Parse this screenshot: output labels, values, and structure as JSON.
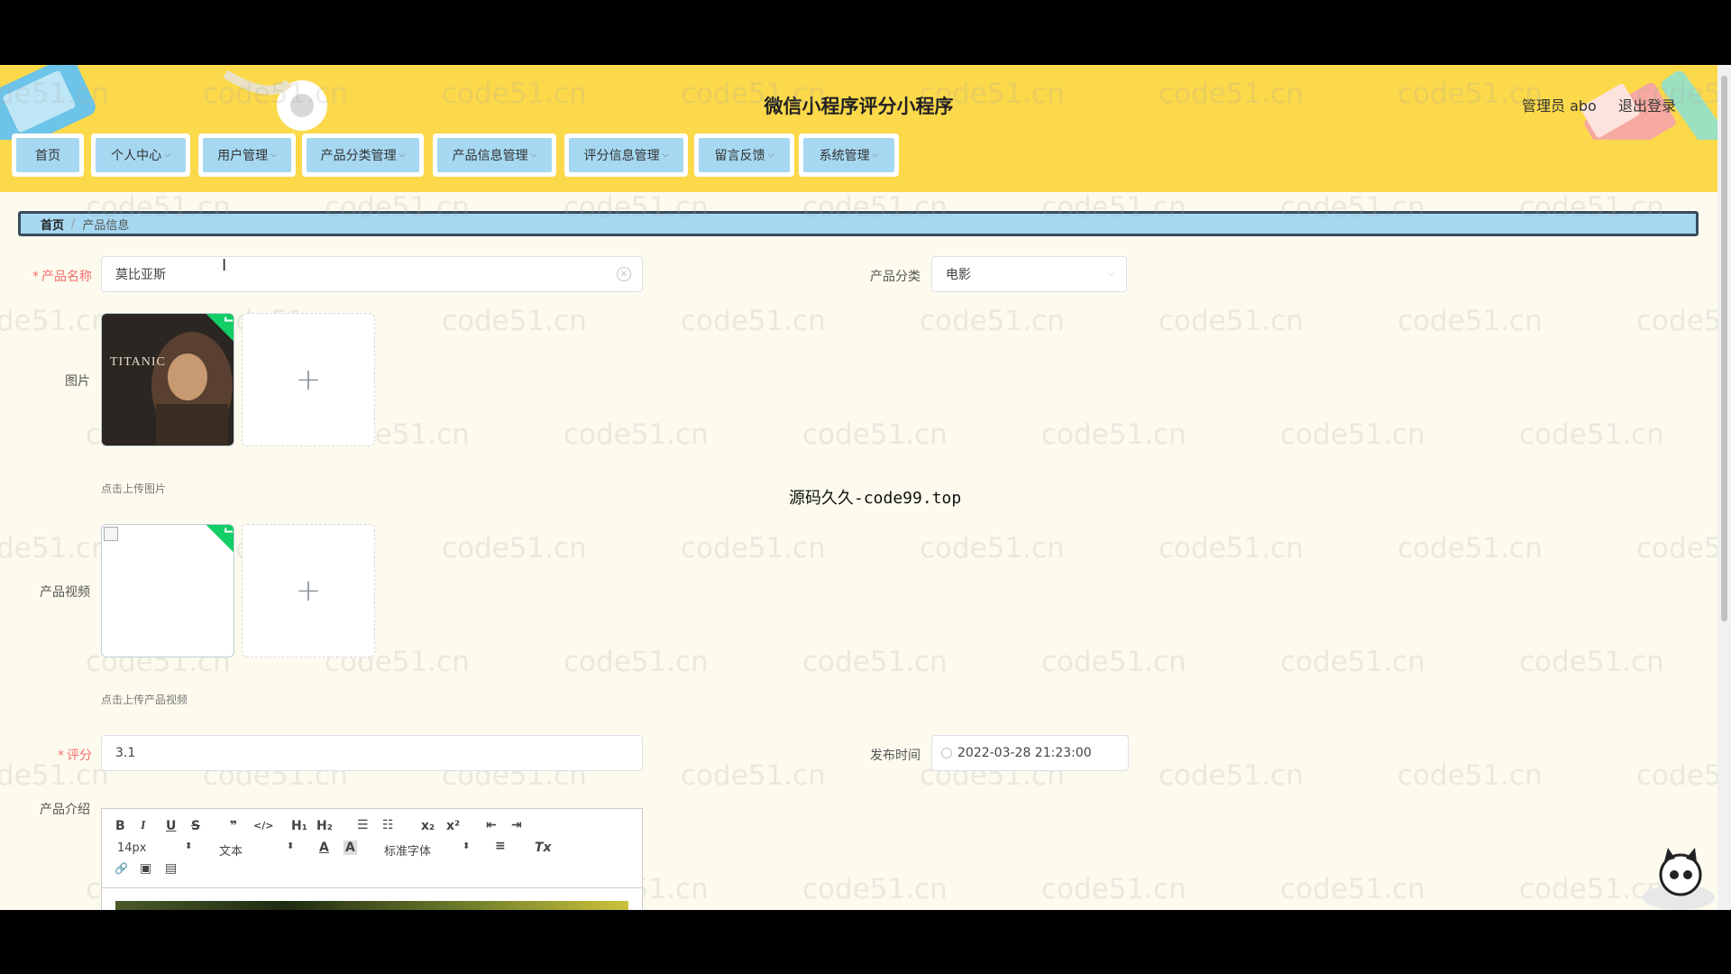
{
  "app": {
    "title": "微信小程序评分小程序"
  },
  "header": {
    "user": "管理员 abo",
    "logout": "退出登录"
  },
  "nav": [
    {
      "label": "首页",
      "dropdown": false
    },
    {
      "label": "个人中心",
      "dropdown": true
    },
    {
      "label": "用户管理",
      "dropdown": true
    },
    {
      "label": "产品分类管理",
      "dropdown": true
    },
    {
      "label": "产品信息管理",
      "dropdown": true
    },
    {
      "label": "评分信息管理",
      "dropdown": true
    },
    {
      "label": "留言反馈",
      "dropdown": true
    },
    {
      "label": "系统管理",
      "dropdown": true
    }
  ],
  "breadcrumb": {
    "home": "首页",
    "separator": "/",
    "current": "产品信息"
  },
  "watermark": "code51.cn",
  "overlay": "源码久久-code99.top",
  "form": {
    "name": {
      "label": "产品名称",
      "value": "莫比亚斯"
    },
    "category": {
      "label": "产品分类",
      "value": "电影"
    },
    "image": {
      "label": "图片",
      "hint": "点击上传图片",
      "poster_text": "TITANIC"
    },
    "video": {
      "label": "产品视频",
      "hint": "点击上传产品视频"
    },
    "score": {
      "label": "评分",
      "value": "3.1"
    },
    "publish_time": {
      "label": "发布时间",
      "value": "2022-03-28 21:23:00"
    },
    "intro": {
      "label": "产品介绍"
    }
  },
  "editor": {
    "font_size": "14px",
    "block_type": "文本",
    "font_family": "标准字体",
    "buttons": {
      "bold": "B",
      "italic": "I",
      "underline": "U",
      "strike": "S",
      "quote": "❞",
      "code": "</>",
      "h1": "H₁",
      "h2": "H₂",
      "ol": "☰",
      "ul": "☷",
      "sub": "x₂",
      "sup": "x²",
      "outdent": "⇤",
      "indent": "⇥",
      "color": "A",
      "background": "A",
      "align": "≡",
      "clean": "Tx",
      "link": "🔗",
      "image": "▣",
      "video": "▤"
    }
  },
  "colors": {
    "header": "#fbd94a",
    "nav_item": "#a6d8f2",
    "breadcrumb_border": "#3a4b5c",
    "required": "#f56c6c",
    "success": "#13ce66"
  }
}
